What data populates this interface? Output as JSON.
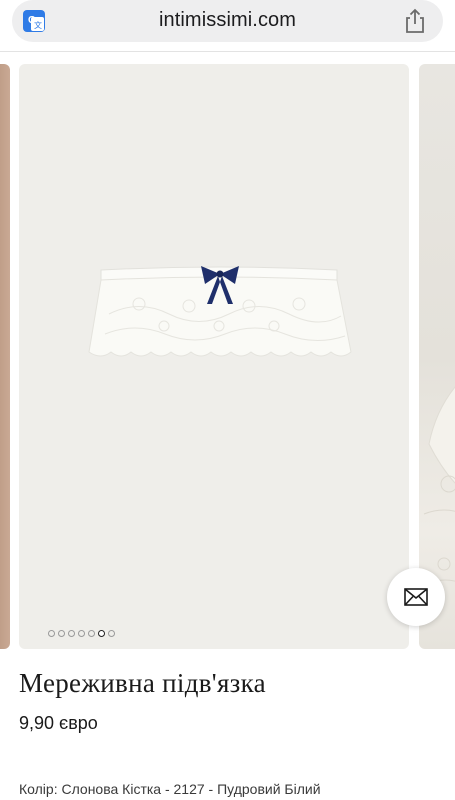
{
  "browser": {
    "url": "intimissimi.com",
    "translate_icon": "translate-icon",
    "share_icon": "share-icon"
  },
  "carousel": {
    "image_count": 7,
    "active_index": 5
  },
  "product": {
    "name": "Мереживна підв'язка",
    "price": "9,90 євро",
    "color_line": "Колір: Слонова Кістка - 2127 - Пудровий Білий"
  },
  "contact_fab": {
    "icon": "mail-icon"
  },
  "colors": {
    "slide_bg": "#efeeea",
    "bow": "#1f2f6b",
    "lace": "#ffffff"
  }
}
